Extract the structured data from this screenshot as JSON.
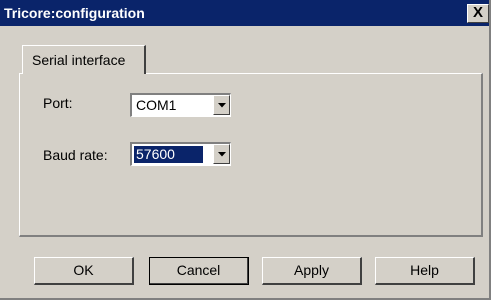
{
  "window": {
    "title": "Tricore:configuration",
    "close_label": "X"
  },
  "tabs": [
    {
      "label": "Serial interface",
      "active": true
    }
  ],
  "serial": {
    "port_label": "Port:",
    "port_value": "COM1",
    "baud_label": "Baud rate:",
    "baud_value": "57600"
  },
  "buttons": {
    "ok": "OK",
    "cancel": "Cancel",
    "apply": "Apply",
    "help": "Help"
  },
  "colors": {
    "titlebar": "#0a246a",
    "face": "#d4d0c8",
    "selection": "#0a246a"
  },
  "icons": {
    "close": "close-icon",
    "dropdown": "chevron-down-icon"
  }
}
